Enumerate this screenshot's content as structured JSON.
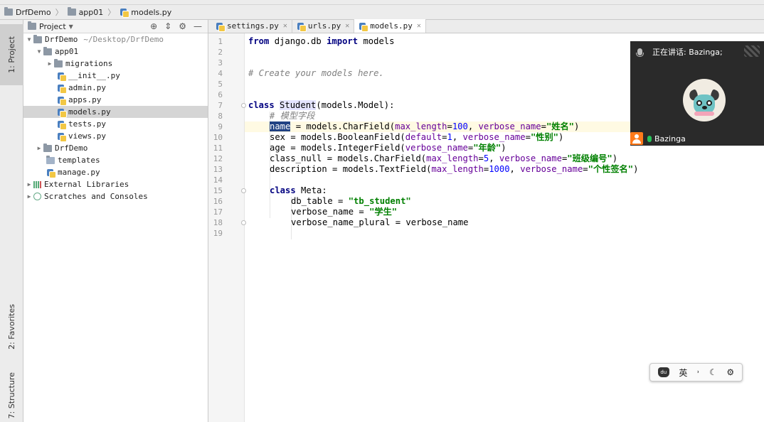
{
  "breadcrumb": {
    "items": [
      "DrfDemo",
      "app01",
      "models.py"
    ]
  },
  "tool_strip": {
    "project_tab": "1: Project",
    "favorites_tab": "2: Favorites",
    "structure_tab": "7: Structure"
  },
  "project_panel": {
    "title": "Project",
    "tree": [
      {
        "label": "DrfDemo",
        "extra": "~/Desktop/DrfDemo"
      },
      {
        "label": "app01"
      },
      {
        "label": "migrations"
      },
      {
        "label": "__init__.py"
      },
      {
        "label": "admin.py"
      },
      {
        "label": "apps.py"
      },
      {
        "label": "models.py"
      },
      {
        "label": "tests.py"
      },
      {
        "label": "views.py"
      },
      {
        "label": "DrfDemo"
      },
      {
        "label": "templates"
      },
      {
        "label": "manage.py"
      },
      {
        "label": "External Libraries"
      },
      {
        "label": "Scratches and Consoles"
      }
    ]
  },
  "tabs": [
    {
      "label": "settings.py"
    },
    {
      "label": "urls.py"
    },
    {
      "label": "models.py"
    }
  ],
  "editor": {
    "line_numbers": [
      "1",
      "2",
      "3",
      "4",
      "5",
      "6",
      "7",
      "8",
      "9",
      "10",
      "11",
      "12",
      "13",
      "14",
      "15",
      "16",
      "17",
      "18",
      "19"
    ],
    "line1": {
      "kw1": "from",
      "mod": " django.db ",
      "kw2": "import",
      "rest": " models"
    },
    "line4": {
      "comment": "# Create your models here."
    },
    "line7": {
      "kw": "class",
      "cls": "Student",
      "rest": "(models.Model):"
    },
    "line8": {
      "comment": "# 模型字段"
    },
    "line9": {
      "sel": "name",
      "a": " = models.CharField(",
      "k1": "max_length",
      "eq1": "=",
      "n1": "100",
      "c1": ", ",
      "k2": "verbose_name",
      "eq2": "=",
      "s1": "\"姓名\"",
      "end": ")"
    },
    "line10": {
      "a": "sex = models.BooleanField(",
      "k1": "default",
      "eq1": "=",
      "n1": "1",
      "c1": ", ",
      "k2": "verbose_name",
      "eq2": "=",
      "s1": "\"性别\"",
      "end": ")"
    },
    "line11": {
      "a": "age = models.IntegerField(",
      "k1": "verbose_name",
      "eq1": "=",
      "s1": "\"年龄\"",
      "end": ")"
    },
    "line12": {
      "a": "class_null = models.CharField(",
      "k1": "max_length",
      "eq1": "=",
      "n1": "5",
      "c1": ", ",
      "k2": "verbose_name",
      "eq2": "=",
      "s1": "\"班级编号\"",
      "end": ")"
    },
    "line13": {
      "a": "description = models.TextField(",
      "k1": "max_length",
      "eq1": "=",
      "n1": "1000",
      "c1": ", ",
      "k2": "verbose_name",
      "eq2": "=",
      "s1": "\"个性签名\"",
      "end": ")"
    },
    "line15": {
      "kw": "class",
      "rest": " Meta:"
    },
    "line16": {
      "a": "db_table = ",
      "s1": "\"tb_student\""
    },
    "line17": {
      "a": "verbose_name = ",
      "s1": "\"学生\""
    },
    "line18": {
      "a": "verbose_name_plural = verbose_name"
    }
  },
  "call": {
    "speaking": "正在讲话: Bazinga;",
    "user": "Bazinga"
  },
  "ime": {
    "lang": "英",
    "punct": "˒",
    "moon": "☾",
    "gear": "⚙"
  }
}
